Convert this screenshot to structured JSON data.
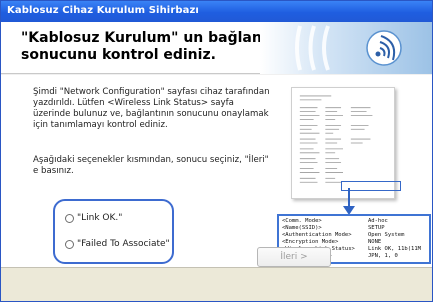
{
  "window": {
    "title": "Kablosuz Cihaz Kurulum Sihirbazı"
  },
  "header": {
    "title_line1": "\"Kablosuz Kurulum\" un bağlantı",
    "title_line2": "sonucunu kontrol ediniz."
  },
  "instructions": {
    "paragraph1": "Şimdi \"Network Configuration\" sayfası cihaz tarafından yazdırıldı. Lütfen <Wireless Link Status> sayfa üzerinde bulunuz ve, bağlantının sonucunu onaylamak için tanımlamayı kontrol ediniz.",
    "paragraph2": "Aşağıdaki seçenekler kısmından, sonucu seçiniz, \"İleri\" e basınız."
  },
  "options": [
    {
      "label": "\"Link OK.\"",
      "selected": false
    },
    {
      "label": "\"Failed To Associate\"",
      "selected": false
    }
  ],
  "status_box": {
    "rows": [
      {
        "key": "<Comm. Mode>",
        "value": "Ad-hoc"
      },
      {
        "key": "<Name(SSID)>",
        "value": "SETUP"
      },
      {
        "key": "<Authentication Mode>",
        "value": "Open System"
      },
      {
        "key": "<Encryption Mode>",
        "value": "NONE"
      },
      {
        "key": "<Wireless Link Status>",
        "value": "Link OK, 11b(11M"
      },
      {
        "key": "<Tx Power Code>",
        "value": "JPN, 1, 0"
      }
    ]
  },
  "buttons": {
    "next_label": "İleri >",
    "next_enabled": false
  },
  "icons": {
    "banner": "wireless-signal-icon",
    "radio": "radio-button-icon",
    "arrow": "down-arrow-icon"
  },
  "colors": {
    "title_bar": "#2059d6",
    "accent": "#3d6bd0",
    "banner_wave": "#3f80c8"
  }
}
